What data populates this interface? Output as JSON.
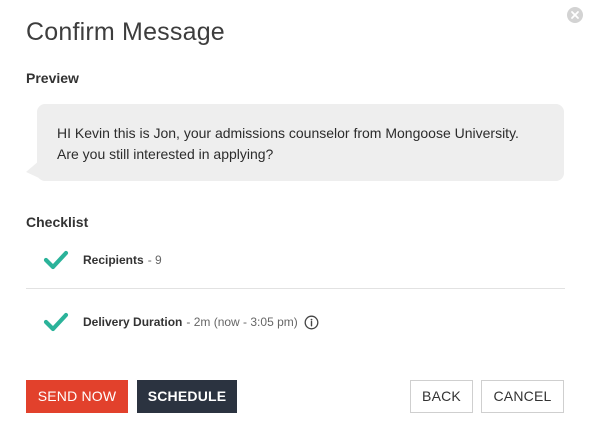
{
  "dialog": {
    "title": "Confirm Message",
    "close_icon": "close-icon"
  },
  "preview": {
    "label": "Preview",
    "message_line1": "HI Kevin this is Jon, your admissions counselor from Mongoose University.",
    "message_line2": "Are you still interested in applying?"
  },
  "checklist": {
    "label": "Checklist",
    "items": [
      {
        "icon": "checkmark-icon",
        "label": "Recipients",
        "detail": "- 9"
      },
      {
        "icon": "checkmark-icon",
        "label": "Delivery Duration",
        "detail": "- 2m (now - 3:05 pm)",
        "info_icon": "info-icon"
      }
    ]
  },
  "buttons": {
    "send_now": "SEND NOW",
    "schedule": "SCHEDULE",
    "back": "BACK",
    "cancel": "CANCEL"
  },
  "colors": {
    "check": "#2bb39a",
    "send_now_bg": "#e2412c",
    "schedule_bg": "#2b3340",
    "bubble_bg": "#eeeeee"
  }
}
